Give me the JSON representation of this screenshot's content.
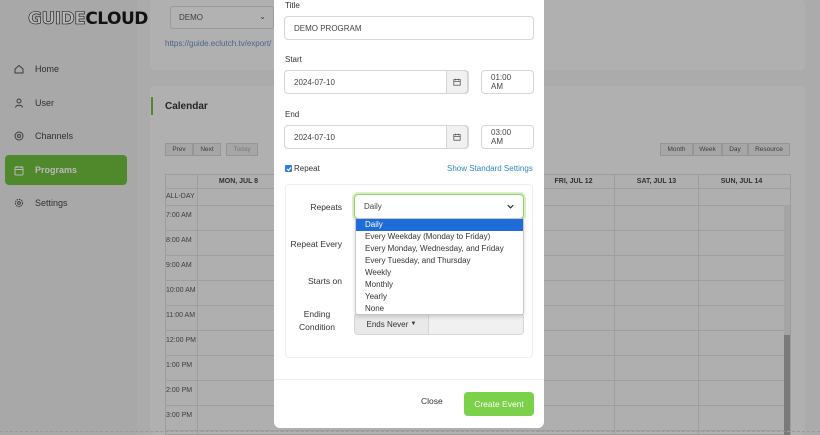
{
  "app": {
    "logo_part1": "GUIDE",
    "logo_part2": "CLOUD"
  },
  "sidebar": {
    "items": [
      {
        "label": "Home",
        "icon": "home-icon"
      },
      {
        "label": "User",
        "icon": "user-icon"
      },
      {
        "label": "Channels",
        "icon": "channels-icon"
      },
      {
        "label": "Programs",
        "icon": "calendar-icon",
        "active": true
      },
      {
        "label": "Settings",
        "icon": "gear-icon"
      }
    ]
  },
  "top": {
    "program_select": "DEMO",
    "export_url": "https://guide.eclutch.tv/export/"
  },
  "calendar": {
    "title": "Calendar",
    "nav": {
      "prev": "Prev",
      "next": "Next",
      "today": "Today"
    },
    "views": {
      "month": "Month",
      "week": "Week",
      "day": "Day",
      "resource": "Resource"
    },
    "days": [
      "MON, JUL 8",
      "FRI, JUL 12",
      "SAT, JUL 13",
      "SUN, JUL 14"
    ],
    "all_day": "ALL-DAY",
    "times": [
      "7:00 AM",
      "8:00 AM",
      "9:00 AM",
      "10:00 AM",
      "11:00 AM",
      "12:00 PM",
      "1:00 PM",
      "2:00 PM",
      "3:00 PM"
    ]
  },
  "modal": {
    "title_label": "Title",
    "title_value": "DEMO PROGRAM",
    "start_label": "Start",
    "start_date": "2024-07-10",
    "start_time": "01:00 AM",
    "end_label": "End",
    "end_date": "2024-07-10",
    "end_time": "03:00 AM",
    "repeat_label": "Repeat",
    "repeat_checked": true,
    "standard_settings_link": "Show Standard Settings",
    "repeats_label": "Repeats",
    "repeats_value": "Daily",
    "repeat_every_label": "Repeat Every",
    "starts_on_label": "Starts on",
    "ending_label_line1": "Ending",
    "ending_label_line2": "Condition",
    "ends_value": "Ends Never",
    "dropdown_options": [
      "Daily",
      "Every Weekday (Monday to Friday)",
      "Every Monday, Wednesday, and Friday",
      "Every Tuesday, and Thursday",
      "Weekly",
      "Monthly",
      "Yearly",
      "None"
    ],
    "close_label": "Close",
    "create_label": "Create Event"
  },
  "colors": {
    "accent": "#6fbe3c",
    "create_button": "#7bd14a",
    "selected_option": "#1e6cd8",
    "link": "#2f86c8"
  }
}
